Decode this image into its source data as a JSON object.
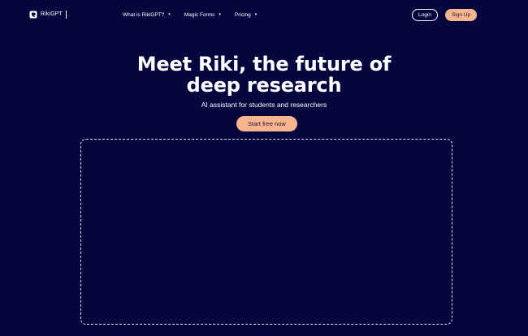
{
  "navbar": {
    "brand": {
      "name": "RikiGPT",
      "logo_icon": "riki-logo-icon"
    },
    "links": [
      {
        "label": "What is RikiGPT?",
        "caret": "▾"
      },
      {
        "label": "Magic Forms",
        "caret": "▾"
      },
      {
        "label": "Pricing",
        "caret": "▾"
      }
    ],
    "login_label": "Login",
    "signup_label": "Sign Up"
  },
  "hero": {
    "title_line1": "Meet Riki, the future of",
    "title_line2": "deep research",
    "subtitle": "AI assistant for students and researchers",
    "cta_label": "Start free now"
  },
  "colors": {
    "background": "#06063e",
    "accent": "#f8b48d",
    "text": "#ffffff",
    "dashed_border": "#e8e8f0"
  }
}
